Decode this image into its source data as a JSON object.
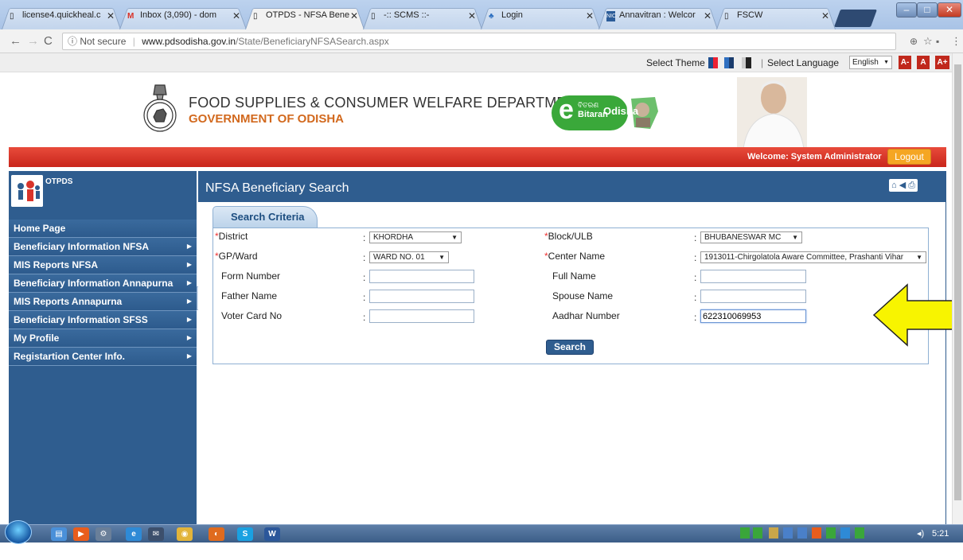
{
  "browser": {
    "tabs": [
      {
        "title": "license4.quickheal.c",
        "icon": "page-icon"
      },
      {
        "title": "Inbox (3,090) - dom",
        "icon": "gmail-icon"
      },
      {
        "title": "OTPDS - NFSA Bene",
        "icon": "page-icon",
        "active": true
      },
      {
        "title": "-:: SCMS ::-",
        "icon": "page-icon"
      },
      {
        "title": "Login",
        "icon": "site-icon"
      },
      {
        "title": "Annavitran : Welcor",
        "icon": "nic-icon"
      },
      {
        "title": "FSCW",
        "icon": "page-icon"
      }
    ],
    "address": {
      "security": "Not secure",
      "host": "www.pdsodisha.gov.in",
      "path": "/State/BeneficiaryNFSASearch.aspx"
    }
  },
  "themebar": {
    "select_theme": "Select Theme",
    "select_language": "Select Language",
    "language": "English",
    "font_buttons": [
      "A-",
      "A",
      "A+"
    ],
    "theme_colors": [
      "#1f4f8f",
      "#2f6fc0",
      "#444444"
    ]
  },
  "header": {
    "title": "FOOD SUPPLIES & CONSUMER WELFARE DEPARTMENT",
    "subtitle": "GOVERNMENT OF ODISHA",
    "logo_main": "e",
    "logo_small": "ବିତରଣ",
    "logo_sub": "Bitaran",
    "logo_state": "Odisha"
  },
  "userbar": {
    "welcome": "Welcome: System Administrator",
    "logout": "Logout"
  },
  "sidebar": {
    "title": "OTPDS",
    "items": [
      {
        "label": "Home Page",
        "has_arrow": false
      },
      {
        "label": "Beneficiary Information NFSA",
        "has_arrow": true
      },
      {
        "label": "MIS Reports NFSA",
        "has_arrow": true
      },
      {
        "label": "Beneficiary Information Annapurna",
        "has_arrow": true
      },
      {
        "label": "MIS Reports Annapurna",
        "has_arrow": true
      },
      {
        "label": "Beneficiary Information SFSS",
        "has_arrow": true
      },
      {
        "label": "My Profile",
        "has_arrow": true
      },
      {
        "label": "Registartion Center Info.",
        "has_arrow": true
      }
    ]
  },
  "main": {
    "title": "NFSA Beneficiary Search",
    "tab": "Search Criteria",
    "fields": {
      "district": {
        "label": "District",
        "value": "KHORDHA"
      },
      "block": {
        "label": "Block/ULB",
        "value": "BHUBANESWAR MC"
      },
      "gp": {
        "label": "GP/Ward",
        "value": "WARD NO. 01"
      },
      "center": {
        "label": "Center Name",
        "value": "1913011-Chirgolatola Aware Committee, Prashanti Vihar"
      },
      "form_number": {
        "label": "Form Number",
        "value": ""
      },
      "full_name": {
        "label": "Full Name",
        "value": ""
      },
      "father_name": {
        "label": "Father Name",
        "value": ""
      },
      "spouse_name": {
        "label": "Spouse Name",
        "value": ""
      },
      "voter_card": {
        "label": "Voter Card No",
        "value": ""
      },
      "aadhar": {
        "label": "Aadhar Number",
        "value": "622310069953"
      }
    },
    "search_button": "Search"
  },
  "taskbar": {
    "clock": "5:21 AM"
  }
}
